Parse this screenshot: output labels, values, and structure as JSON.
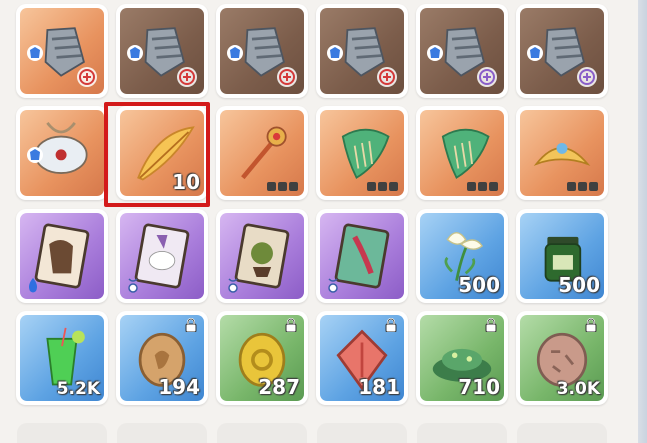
{
  "inventory": {
    "rows": [
      [
        {
          "rarity": "orange",
          "icon": "gauntlet-icon",
          "badge_tl": "armor-icon",
          "badge_br": "red-emblem-icon"
        },
        {
          "rarity": "brown",
          "icon": "gauntlet-icon",
          "badge_tl": "armor-icon",
          "badge_br": "red-emblem-icon"
        },
        {
          "rarity": "brown",
          "icon": "gauntlet-icon",
          "badge_tl": "armor-icon",
          "badge_br": "red-emblem-icon"
        },
        {
          "rarity": "brown",
          "icon": "gauntlet-icon",
          "badge_tl": "armor-icon",
          "badge_br": "red-emblem-icon"
        },
        {
          "rarity": "brown",
          "icon": "gauntlet-icon",
          "badge_tl": "armor-icon",
          "badge_br": "purple-emblem-icon"
        },
        {
          "rarity": "brown",
          "icon": "gauntlet-icon",
          "badge_tl": "armor-icon",
          "badge_br": "purple-emblem-icon"
        }
      ],
      [
        {
          "rarity": "orange",
          "icon": "rope-armor-icon",
          "badge_tl": "armor-icon"
        },
        {
          "rarity": "orange",
          "icon": "golden-feather-icon",
          "count": "10",
          "selected": true
        },
        {
          "rarity": "orange",
          "icon": "ornate-wand-icon",
          "locks": 3
        },
        {
          "rarity": "orange",
          "icon": "green-harp-icon",
          "locks": 3
        },
        {
          "rarity": "orange",
          "icon": "green-harp-icon",
          "locks": 3
        },
        {
          "rarity": "orange",
          "icon": "golden-crown-icon",
          "locks": 3
        }
      ],
      [
        {
          "rarity": "purple",
          "icon": "card-brown-beast-icon",
          "badge_bl": "blue-flame-icon"
        },
        {
          "rarity": "purple",
          "icon": "card-white-creature-icon",
          "badge_bl": "amulet-icon"
        },
        {
          "rarity": "purple",
          "icon": "card-green-goblin-icon",
          "badge_bl": "amulet-icon"
        },
        {
          "rarity": "purple",
          "icon": "card-red-dancer-icon",
          "badge_bl": "amulet-icon"
        },
        {
          "rarity": "blue",
          "icon": "white-lily-icon",
          "count": "500"
        },
        {
          "rarity": "blue",
          "icon": "green-jar-icon",
          "count": "500"
        }
      ],
      [
        {
          "rarity": "blue",
          "icon": "green-drink-icon",
          "count": "5.2K"
        },
        {
          "rarity": "blue",
          "icon": "bronze-coin-icon",
          "count": "194",
          "locked": true
        },
        {
          "rarity": "green",
          "icon": "gold-ring-coin-icon",
          "count": "287",
          "locked": true
        },
        {
          "rarity": "blue",
          "icon": "red-gem-icon",
          "count": "181",
          "locked": true
        },
        {
          "rarity": "green",
          "icon": "green-leaves-pile-icon",
          "count": "710",
          "locked": true
        },
        {
          "rarity": "green",
          "icon": "silver-coin-icon",
          "count": "3.0K",
          "locked": true
        }
      ]
    ]
  },
  "colors": {
    "selection": "#d31a1a",
    "orange": "#e8935f",
    "brown": "#7c5d4b",
    "purple": "#a97ddb",
    "blue": "#5ea3e3",
    "green": "#78b66a"
  }
}
